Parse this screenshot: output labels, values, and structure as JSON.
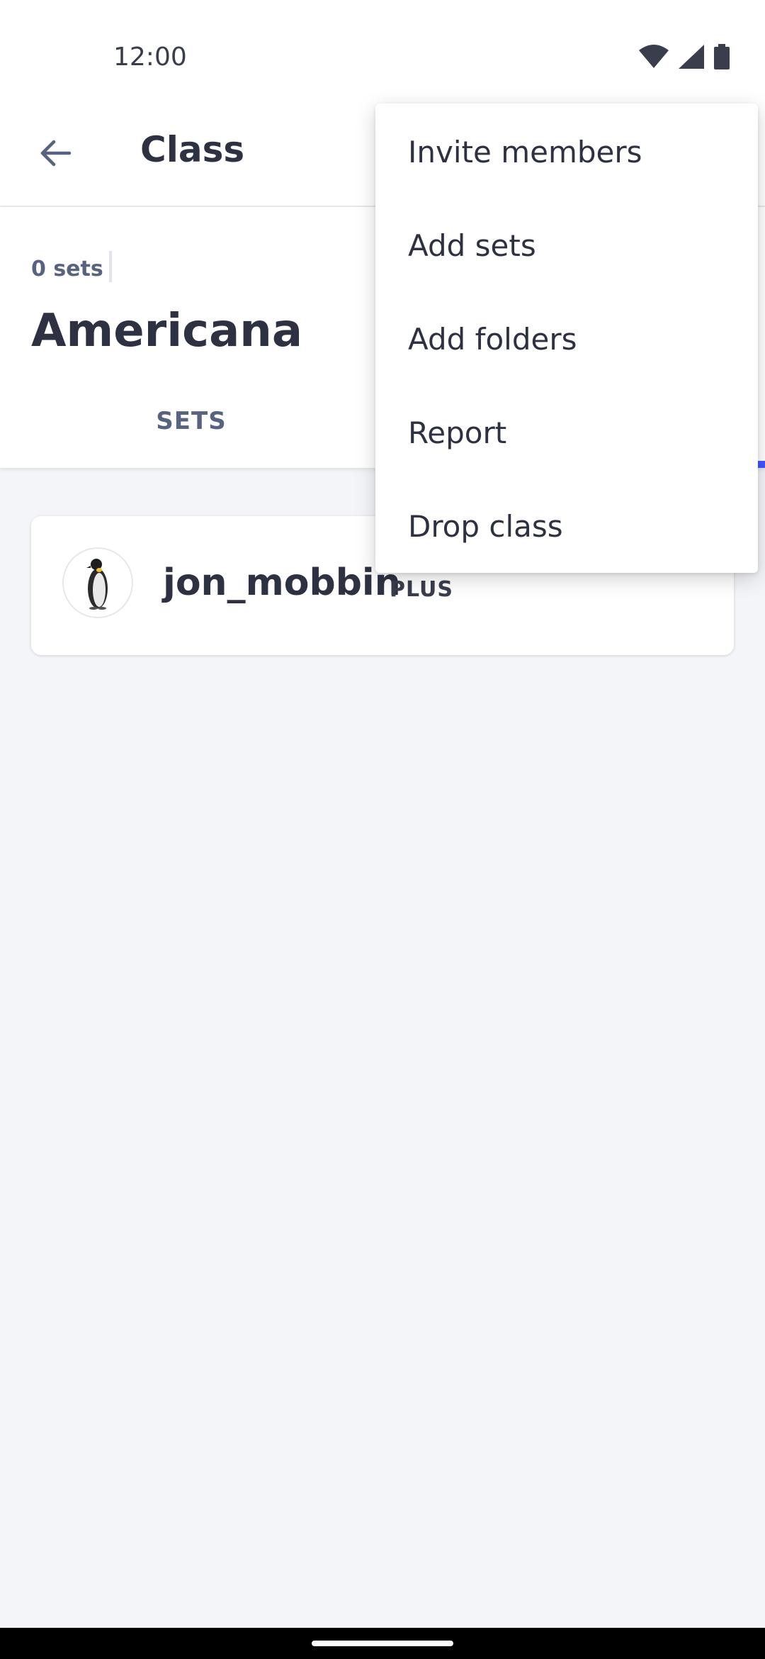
{
  "status_bar": {
    "time": "12:00",
    "icons": [
      "wifi-icon",
      "cellular-signal-icon",
      "battery-icon"
    ]
  },
  "app_bar": {
    "title": "Class",
    "back_icon": "arrow-back-icon"
  },
  "class_header": {
    "sets_count": "0 sets",
    "class_name": "Americana",
    "tabs": [
      {
        "label": "SETS",
        "selected": false
      }
    ]
  },
  "members": [
    {
      "username": "jon_mobbin",
      "badge": "PLUS",
      "avatar_icon": "penguin-avatar"
    }
  ],
  "overflow_menu": {
    "items": [
      {
        "label": "Invite members"
      },
      {
        "label": "Add sets"
      },
      {
        "label": "Add folders"
      },
      {
        "label": "Report"
      },
      {
        "label": "Drop class"
      }
    ]
  },
  "colors": {
    "accent": "#4255ff",
    "background": "#f4f5f9",
    "text_primary": "#2e3142",
    "text_secondary": "#586380"
  }
}
